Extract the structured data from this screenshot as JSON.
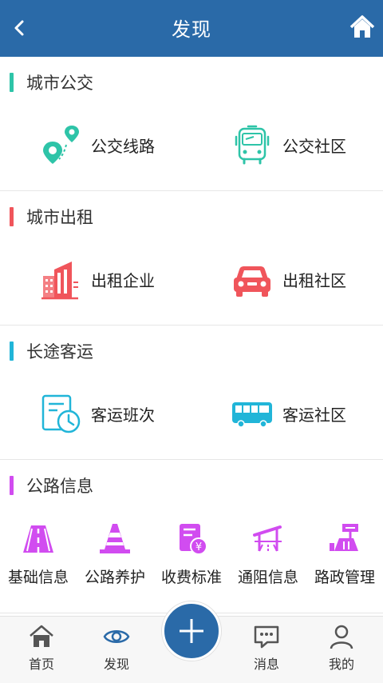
{
  "header": {
    "title": "发现"
  },
  "sections": [
    {
      "title": "城市公交",
      "color": "#2ec4a8",
      "items": [
        {
          "label": "公交线路",
          "icon": "map-pin-route-icon"
        },
        {
          "label": "公交社区",
          "icon": "bus-front-icon"
        }
      ]
    },
    {
      "title": "城市出租",
      "color": "#f0555b",
      "items": [
        {
          "label": "出租企业",
          "icon": "building-icon"
        },
        {
          "label": "出租社区",
          "icon": "car-icon"
        }
      ]
    },
    {
      "title": "长途客运",
      "color": "#21b5d8",
      "items": [
        {
          "label": "客运班次",
          "icon": "schedule-clock-icon"
        },
        {
          "label": "客运社区",
          "icon": "coach-bus-icon"
        }
      ]
    },
    {
      "title": "公路信息",
      "color": "#d14cf0",
      "items": [
        {
          "label": "基础信息",
          "icon": "road-icon"
        },
        {
          "label": "公路养护",
          "icon": "traffic-cone-icon"
        },
        {
          "label": "收费标准",
          "icon": "toll-fee-icon"
        },
        {
          "label": "通阻信息",
          "icon": "road-barrier-icon"
        },
        {
          "label": "路政管理",
          "icon": "road-admin-icon"
        }
      ]
    }
  ],
  "tabbar": {
    "home": "首页",
    "discover": "发现",
    "messages": "消息",
    "mine": "我的"
  }
}
